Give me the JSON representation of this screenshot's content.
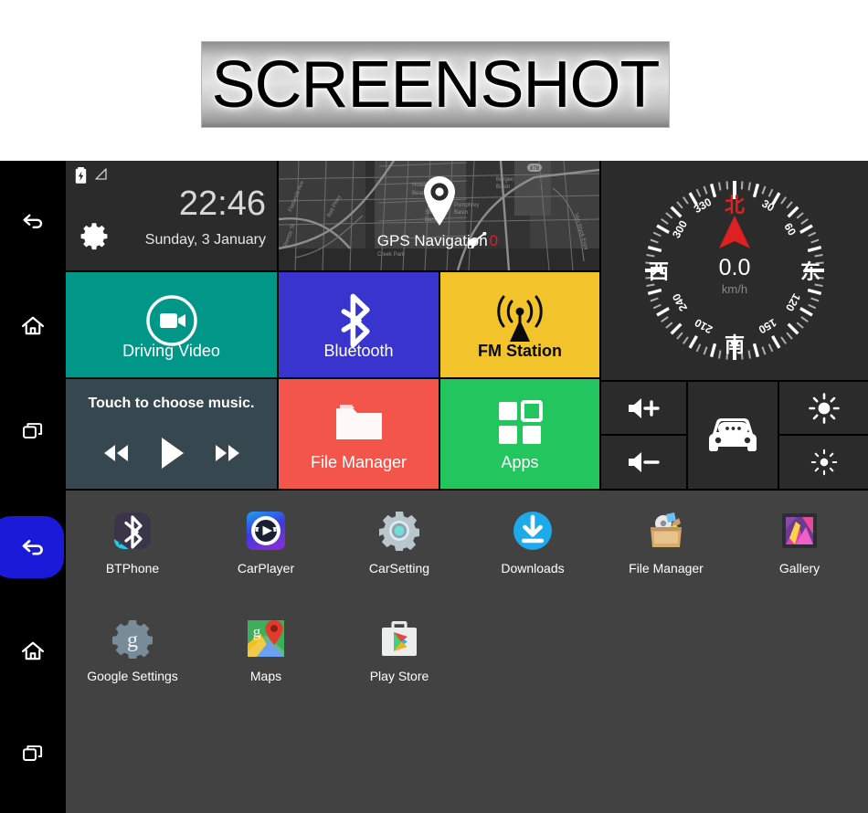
{
  "banner": {
    "text": "SCREENSHOT"
  },
  "sidebar": {
    "items": [
      {
        "name": "back",
        "icon": "back-icon",
        "active": false
      },
      {
        "name": "home",
        "icon": "home-icon",
        "active": false
      },
      {
        "name": "recents",
        "icon": "recents-icon",
        "active": false
      },
      {
        "name": "back",
        "icon": "back-icon",
        "active": true
      },
      {
        "name": "home",
        "icon": "home-icon",
        "active": false
      },
      {
        "name": "recents",
        "icon": "recents-icon",
        "active": false
      }
    ]
  },
  "dashboard": {
    "clock": {
      "time": "22:46",
      "date": "Sunday, 3 January",
      "battery_icon": "battery-charging-icon",
      "signal_icon": "signal-icon",
      "settings_icon": "gear-icon"
    },
    "gps": {
      "label": "GPS Navigation",
      "satellite_icon": "satellite-dish-icon",
      "satellite_count": "0",
      "pin_icon": "map-pin-icon"
    },
    "compass": {
      "speed": "0.0",
      "unit": "km/h",
      "north": "北",
      "east": "东",
      "south": "南",
      "west": "西",
      "degrees": [
        "30",
        "60",
        "120",
        "150",
        "210",
        "240",
        "300",
        "330"
      ],
      "needle_color": "#e02020"
    },
    "tiles": [
      {
        "label": "Driving Video",
        "icon": "video-camera-icon",
        "color": "#009688",
        "text_color": "#ffffff"
      },
      {
        "label": "Bluetooth",
        "icon": "bluetooth-icon",
        "color": "#3a34cf",
        "text_color": "#ffffff"
      },
      {
        "label": "FM Station",
        "icon": "radio-tower-icon",
        "color": "#f3c32c",
        "text_color": "#0a0a0a"
      },
      {
        "label": "File Manager",
        "icon": "folder-icon",
        "color": "#f4554a",
        "text_color": "#ffffff"
      },
      {
        "label": "Apps",
        "icon": "apps-grid-icon",
        "color": "#22c55e",
        "text_color": "#ffffff"
      }
    ],
    "music": {
      "title": "Touch to choose music.",
      "prev_icon": "rewind-icon",
      "play_icon": "play-icon",
      "next_icon": "fast-forward-icon"
    },
    "controls": [
      {
        "name": "volume-up",
        "icon": "volume-up-icon"
      },
      {
        "name": "volume-down",
        "icon": "volume-down-icon"
      },
      {
        "name": "car-assistant",
        "icon": "car-chat-icon"
      },
      {
        "name": "brightness-up",
        "icon": "brightness-high-icon"
      },
      {
        "name": "brightness-down",
        "icon": "brightness-low-icon"
      }
    ]
  },
  "drawer": {
    "apps": [
      {
        "label": "BTPhone",
        "icon": "btphone-icon"
      },
      {
        "label": "CarPlayer",
        "icon": "carplayer-icon"
      },
      {
        "label": "CarSetting",
        "icon": "carsetting-icon"
      },
      {
        "label": "Downloads",
        "icon": "downloads-icon"
      },
      {
        "label": "File Manager",
        "icon": "file-manager-icon"
      },
      {
        "label": "Gallery",
        "icon": "gallery-icon"
      },
      {
        "label": "Google Settings",
        "icon": "google-settings-icon"
      },
      {
        "label": "Maps",
        "icon": "maps-icon"
      },
      {
        "label": "Play Store",
        "icon": "play-store-icon"
      }
    ]
  }
}
